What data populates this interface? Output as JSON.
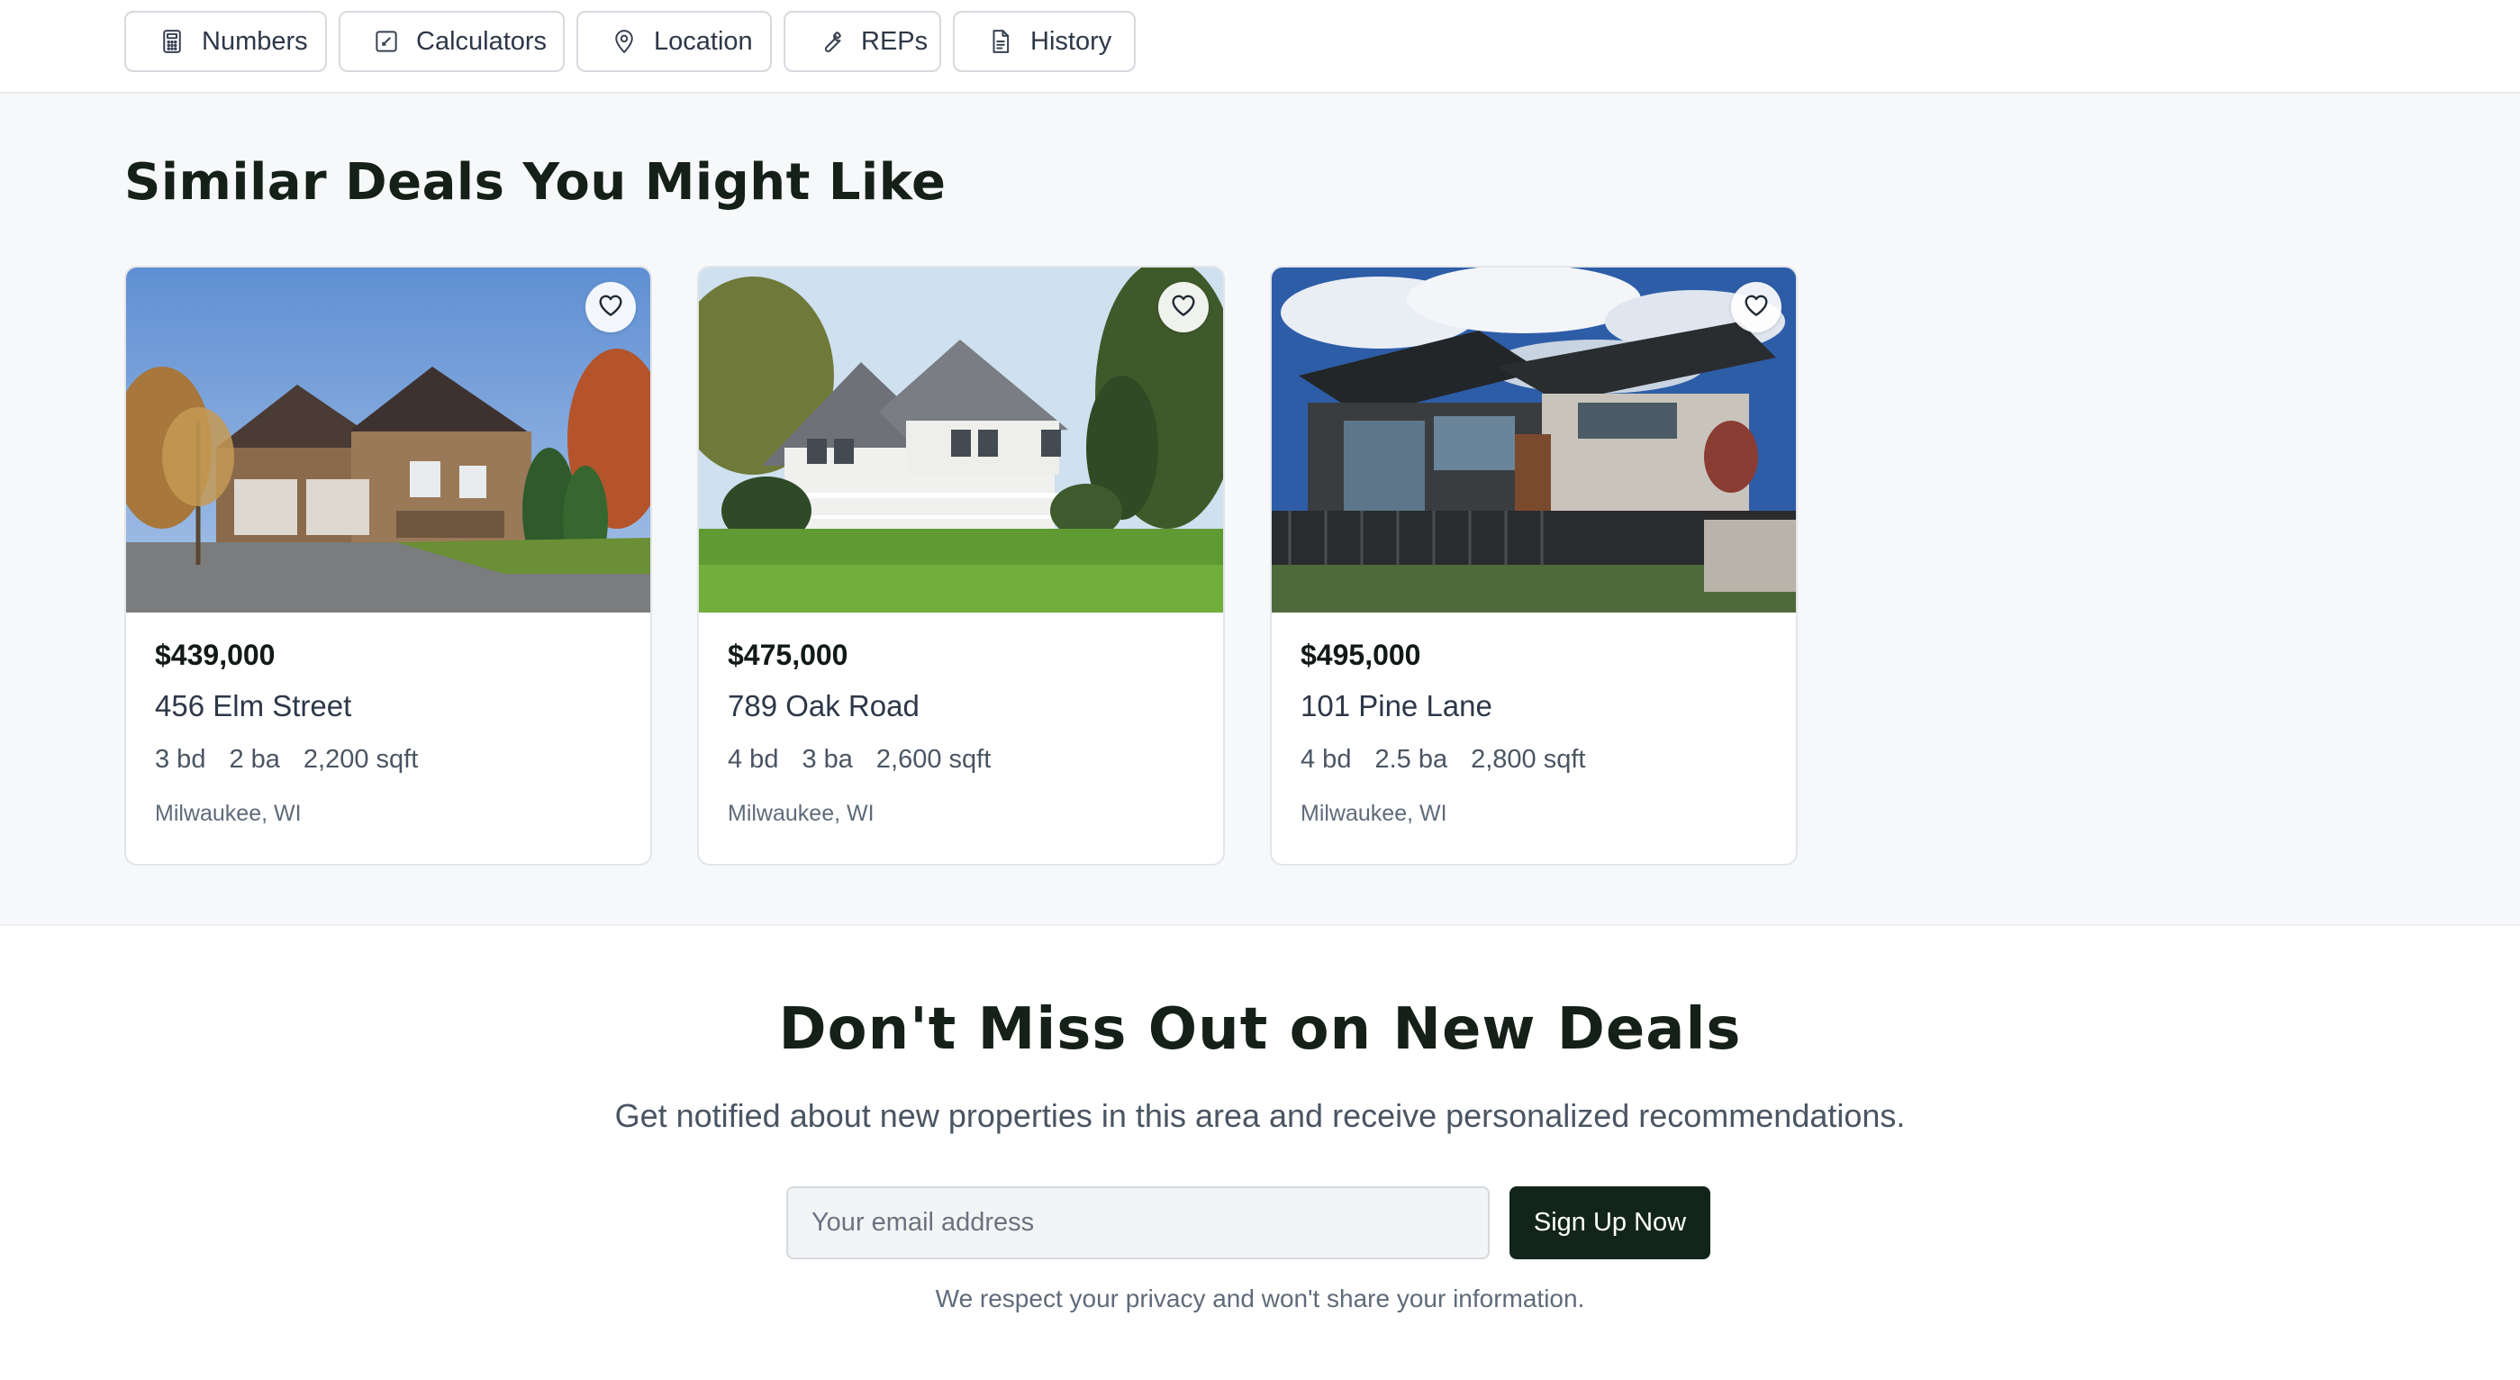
{
  "tabs": [
    {
      "label": "Numbers",
      "icon": "calculator-icon"
    },
    {
      "label": "Calculators",
      "icon": "square-pen-icon"
    },
    {
      "label": "Location",
      "icon": "map-pin-icon"
    },
    {
      "label": "REPs",
      "icon": "wrench-icon"
    },
    {
      "label": "History",
      "icon": "document-icon"
    }
  ],
  "similar": {
    "title": "Similar Deals You Might Like",
    "cards": [
      {
        "price": "$439,000",
        "address": "456 Elm Street",
        "beds": "3 bd",
        "baths": "2 ba",
        "sqft": "2,200 sqft",
        "location": "Milwaukee, WI",
        "favorite_icon": "heart-icon"
      },
      {
        "price": "$475,000",
        "address": "789 Oak Road",
        "beds": "4 bd",
        "baths": "3 ba",
        "sqft": "2,600 sqft",
        "location": "Milwaukee, WI",
        "favorite_icon": "heart-icon"
      },
      {
        "price": "$495,000",
        "address": "101 Pine Lane",
        "beds": "4 bd",
        "baths": "2.5 ba",
        "sqft": "2,800 sqft",
        "location": "Milwaukee, WI",
        "favorite_icon": "heart-icon"
      }
    ]
  },
  "newsletter": {
    "title": "Don't Miss Out on New Deals",
    "subtitle": "Get notified about new properties in this area and receive personalized recommendations.",
    "email_placeholder": "Your email address",
    "email_value": "",
    "button_label": "Sign Up Now",
    "privacy_note": "We respect your privacy and won't share your information."
  },
  "colors": {
    "brand_dark": "#13251b",
    "section_bg": "#f7f8fa",
    "card_border": "#e2e5e9"
  }
}
